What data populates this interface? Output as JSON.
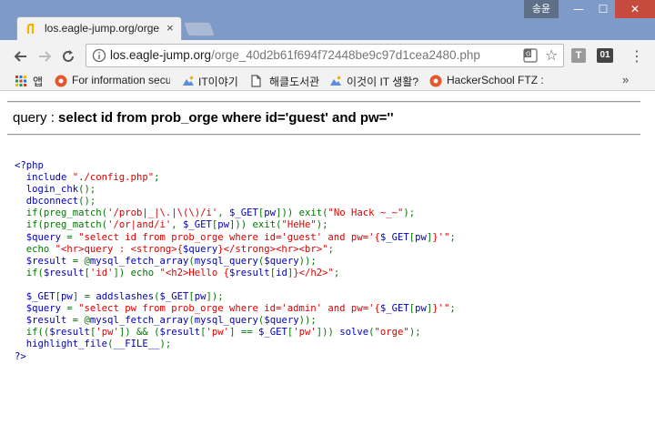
{
  "window": {
    "user_label": "송윤",
    "minimize_glyph": "—",
    "maximize_glyph": "☐",
    "close_glyph": "✕"
  },
  "tab": {
    "title": "los.eagle-jump.org/orge",
    "close_glyph": "×"
  },
  "omnibox": {
    "host": "los.eagle-jump.org",
    "path": "/orge_40d2b61f694f72448be9c97d1cea2480.php",
    "star_glyph": "☆"
  },
  "extensions": {
    "t_label": "T",
    "zero_one_label": "01",
    "menu_glyph": "⋮"
  },
  "bookmarks": {
    "items": [
      {
        "label": "앱",
        "icon": "apps-grid-icon"
      },
      {
        "label": "For information secu",
        "icon": "orange-circle-icon"
      },
      {
        "label": "IT이야기",
        "icon": "mountain-icon"
      },
      {
        "label": "해클도서관",
        "icon": "page-icon"
      },
      {
        "label": "이것이 IT 생활?",
        "icon": "mountain-icon"
      },
      {
        "label": "HackerSchool FTZ : L",
        "icon": "orange-circle-icon"
      }
    ],
    "more_glyph": "»"
  },
  "page": {
    "query_prefix": "query : ",
    "query_text": "select id from prob_orge where id='guest' and pw=''"
  },
  "code": [
    [
      [
        "def",
        "<?php"
      ]
    ],
    [
      [
        "def",
        "  include "
      ],
      [
        "str",
        "\"./config.php\""
      ],
      [
        "kw",
        ";"
      ]
    ],
    [
      [
        "def",
        "  login_chk"
      ],
      [
        "kw",
        "();"
      ]
    ],
    [
      [
        "def",
        "  dbconnect"
      ],
      [
        "kw",
        "();"
      ]
    ],
    [
      [
        "kw",
        "  if(preg_match("
      ],
      [
        "str",
        "'/prob|_|\\.|\\(\\)/i'"
      ],
      [
        "kw",
        ", "
      ],
      [
        "def",
        "$_GET"
      ],
      [
        "kw",
        "["
      ],
      [
        "def",
        "pw"
      ],
      [
        "kw",
        "])) exit("
      ],
      [
        "str",
        "\"No Hack ~_~\""
      ],
      [
        "kw",
        ");"
      ]
    ],
    [
      [
        "kw",
        "  if(preg_match("
      ],
      [
        "str",
        "'/or|and/i'"
      ],
      [
        "kw",
        ", "
      ],
      [
        "def",
        "$_GET"
      ],
      [
        "kw",
        "["
      ],
      [
        "def",
        "pw"
      ],
      [
        "kw",
        "])) exit("
      ],
      [
        "str",
        "\"HeHe\""
      ],
      [
        "kw",
        ");"
      ]
    ],
    [
      [
        "def",
        "  $query "
      ],
      [
        "kw",
        "= "
      ],
      [
        "str",
        "\"select id from prob_orge where id='guest' and pw='{"
      ],
      [
        "def",
        "$_GET"
      ],
      [
        "kw",
        "["
      ],
      [
        "def",
        "pw"
      ],
      [
        "kw",
        "]"
      ],
      [
        "str",
        "}'\""
      ],
      [
        "kw",
        ";"
      ]
    ],
    [
      [
        "kw",
        "  echo "
      ],
      [
        "str",
        "\"<hr>query : <strong>{"
      ],
      [
        "def",
        "$query"
      ],
      [
        "str",
        "}</strong><hr><br>\""
      ],
      [
        "kw",
        ";"
      ]
    ],
    [
      [
        "def",
        "  $result "
      ],
      [
        "kw",
        "= @"
      ],
      [
        "def",
        "mysql_fetch_array"
      ],
      [
        "kw",
        "("
      ],
      [
        "def",
        "mysql_query"
      ],
      [
        "kw",
        "("
      ],
      [
        "def",
        "$query"
      ],
      [
        "kw",
        "));"
      ]
    ],
    [
      [
        "kw",
        "  if("
      ],
      [
        "def",
        "$result"
      ],
      [
        "kw",
        "["
      ],
      [
        "str",
        "'id'"
      ],
      [
        "kw",
        "]) echo "
      ],
      [
        "str",
        "\"<h2>Hello {"
      ],
      [
        "def",
        "$result"
      ],
      [
        "kw",
        "["
      ],
      [
        "def",
        "id"
      ],
      [
        "kw",
        "]"
      ],
      [
        "str",
        "}</h2>\""
      ],
      [
        "kw",
        ";"
      ]
    ],
    [
      [
        "def",
        ""
      ]
    ],
    [
      [
        "def",
        "  $_GET"
      ],
      [
        "kw",
        "["
      ],
      [
        "def",
        "pw"
      ],
      [
        "kw",
        "] = "
      ],
      [
        "def",
        "addslashes"
      ],
      [
        "kw",
        "("
      ],
      [
        "def",
        "$_GET"
      ],
      [
        "kw",
        "["
      ],
      [
        "def",
        "pw"
      ],
      [
        "kw",
        "]);"
      ]
    ],
    [
      [
        "def",
        "  $query "
      ],
      [
        "kw",
        "= "
      ],
      [
        "str",
        "\"select pw from prob_orge where id='admin' and pw='{"
      ],
      [
        "def",
        "$_GET"
      ],
      [
        "kw",
        "["
      ],
      [
        "def",
        "pw"
      ],
      [
        "kw",
        "]"
      ],
      [
        "str",
        "}'\""
      ],
      [
        "kw",
        ";"
      ]
    ],
    [
      [
        "def",
        "  $result "
      ],
      [
        "kw",
        "= @"
      ],
      [
        "def",
        "mysql_fetch_array"
      ],
      [
        "kw",
        "("
      ],
      [
        "def",
        "mysql_query"
      ],
      [
        "kw",
        "("
      ],
      [
        "def",
        "$query"
      ],
      [
        "kw",
        "));"
      ]
    ],
    [
      [
        "kw",
        "  if(("
      ],
      [
        "def",
        "$result"
      ],
      [
        "kw",
        "["
      ],
      [
        "str",
        "'pw'"
      ],
      [
        "kw",
        "]) && ("
      ],
      [
        "def",
        "$result"
      ],
      [
        "kw",
        "["
      ],
      [
        "str",
        "'pw'"
      ],
      [
        "kw",
        "] == "
      ],
      [
        "def",
        "$_GET"
      ],
      [
        "kw",
        "["
      ],
      [
        "str",
        "'pw'"
      ],
      [
        "kw",
        "])) "
      ],
      [
        "def",
        "solve"
      ],
      [
        "kw",
        "("
      ],
      [
        "str",
        "\"orge\""
      ],
      [
        "kw",
        ");"
      ]
    ],
    [
      [
        "def",
        "  highlight_file"
      ],
      [
        "kw",
        "("
      ],
      [
        "def",
        "__FILE__"
      ],
      [
        "kw",
        ");"
      ]
    ],
    [
      [
        "def",
        "?>"
      ]
    ]
  ]
}
